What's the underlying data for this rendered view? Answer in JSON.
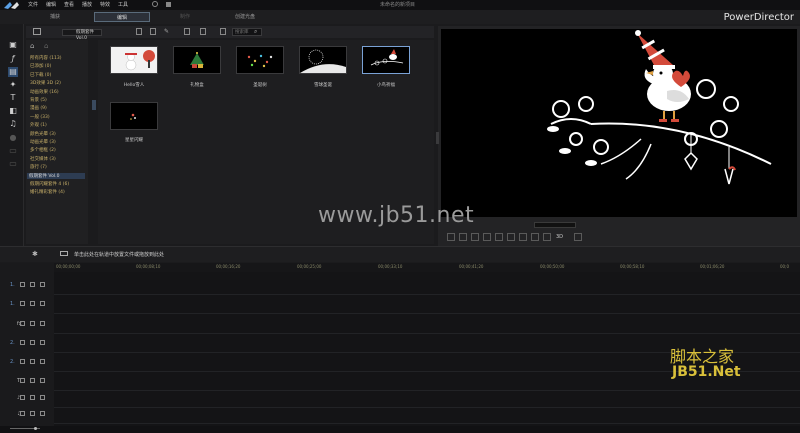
{
  "app": {
    "brand": "PowerDirector",
    "window_title": "未命名的新项目",
    "menu": [
      "文件",
      "编辑",
      "查看",
      "播放",
      "特效",
      "工具"
    ]
  },
  "modes": [
    {
      "label": "捕获",
      "state": "normal"
    },
    {
      "label": "编辑",
      "state": "active"
    },
    {
      "label": "制作",
      "state": "dim"
    },
    {
      "label": "创建光盘",
      "state": "normal"
    }
  ],
  "library": {
    "selected_category": "假期套件 Vol.0",
    "search_placeholder": "搜索库",
    "categories": [
      "所有内容 (113)",
      "已添加 (0)",
      "已下载 (0)",
      "3D效果 3D (2)",
      "动画效果 (16)",
      "背景 (5)",
      "漫画 (9)",
      "一般 (33)",
      "外观 (1)",
      "颜色光晕 (3)",
      "动画光晕 (3)",
      "多个相框 (2)",
      "社交媒体 (3)",
      "旅行 (7)",
      "假期套件 Vol.0",
      "假期闪耀套件 4 (6)",
      "婚礼精彩套件 (4)"
    ],
    "thumbnails": [
      {
        "label": "Hello雪人",
        "selected": false
      },
      {
        "label": "礼物盒",
        "selected": false
      },
      {
        "label": "圣诞树",
        "selected": false
      },
      {
        "label": "雪球圣诞",
        "selected": false
      },
      {
        "label": "小鸟祈福",
        "selected": true
      },
      {
        "label": "星星闪耀",
        "selected": false
      }
    ]
  },
  "timeline": {
    "hint": "单击此处在轨道中放置文件或拖放到此处",
    "ruler_ticks": [
      "00;00;00;00",
      "00;00;08;10",
      "00;00;16;20",
      "00;00;25;00",
      "00;00;33;10",
      "00;00;41;20",
      "00;00;50;00",
      "00;00;58;10",
      "00;01;06;20",
      "00;0"
    ],
    "tracks": [
      "1.",
      "1.",
      "fx",
      "2.",
      "2.",
      "T",
      "♪",
      "♫"
    ],
    "preview_mode": "3D"
  },
  "watermark": {
    "main": "www.jb51.net",
    "corner_cn": "脚本之家",
    "corner_en": "JB51.Net"
  }
}
